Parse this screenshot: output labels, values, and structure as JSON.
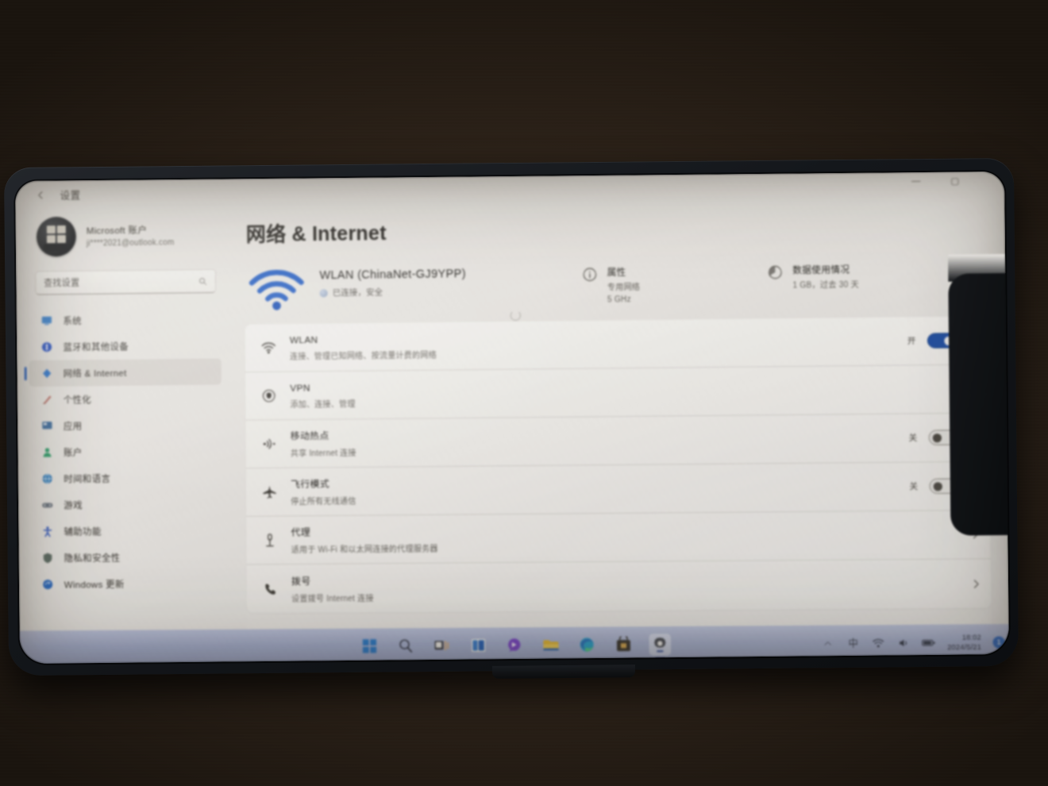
{
  "window": {
    "titlebar_title": "设置",
    "back_icon": "back-arrow-icon",
    "minimize_label": "—",
    "maximize_label": "▢"
  },
  "account": {
    "name": "Microsoft 账户",
    "email": "ji****2021@outlook.com",
    "avatar_icon": "windows-logo-avatar"
  },
  "search": {
    "placeholder": "查找设置",
    "icon": "search-icon"
  },
  "sidebar": {
    "items": [
      {
        "label": "系统",
        "icon": "system-icon",
        "color": "#2c7fd6",
        "active": false
      },
      {
        "label": "蓝牙和其他设备",
        "icon": "bluetooth-icon",
        "color": "#1f4fd0",
        "active": false
      },
      {
        "label": "网络 & Internet",
        "icon": "network-icon",
        "color": "#2677d8",
        "active": true
      },
      {
        "label": "个性化",
        "icon": "personalization-icon",
        "color": "#c0655a",
        "active": false
      },
      {
        "label": "应用",
        "icon": "apps-icon",
        "color": "#3a6ea5",
        "active": false
      },
      {
        "label": "账户",
        "icon": "accounts-icon",
        "color": "#2aa36b",
        "active": false
      },
      {
        "label": "时间和语言",
        "icon": "time-language-icon",
        "color": "#2b7fc4",
        "active": false
      },
      {
        "label": "游戏",
        "icon": "gaming-icon",
        "color": "#6c7580",
        "active": false
      },
      {
        "label": "辅助功能",
        "icon": "accessibility-icon",
        "color": "#2250c8",
        "active": false
      },
      {
        "label": "隐私和安全性",
        "icon": "privacy-security-icon",
        "color": "#5b6b62",
        "active": false
      },
      {
        "label": "Windows 更新",
        "icon": "windows-update-icon",
        "color": "#2268c9",
        "active": false
      }
    ]
  },
  "page": {
    "title": "网络 & Internet",
    "status": {
      "wifi_icon": "wifi-signal-icon",
      "connection_name": "WLAN (ChinaNet-GJ9YPP)",
      "connection_sub": "已连接，安全",
      "connection_sub_icon": "globe-icon",
      "spinner_icon": "loading-spinner-icon",
      "cards": [
        {
          "icon": "properties-info-icon",
          "title": "属性",
          "sub": "专用网络\n5 GHz",
          "chevron": false
        },
        {
          "icon": "data-usage-icon",
          "title": "数据使用情况",
          "sub": "1 GB，过去 30 天",
          "chevron": true
        }
      ]
    },
    "rows": [
      {
        "icon": "wlan-icon",
        "title": "WLAN",
        "sub": "连接、管理已知网络、按流量计费的网络",
        "toggle": {
          "present": true,
          "state": "on",
          "label": "开"
        },
        "chevron": true
      },
      {
        "icon": "vpn-shield-icon",
        "title": "VPN",
        "sub": "添加、连接、管理",
        "toggle": {
          "present": false
        },
        "chevron": true
      },
      {
        "icon": "mobile-hotspot-icon",
        "title": "移动热点",
        "sub": "共享 Internet 连接",
        "toggle": {
          "present": true,
          "state": "off",
          "label": "关"
        },
        "chevron": true
      },
      {
        "icon": "airplane-mode-icon",
        "title": "飞行模式",
        "sub": "停止所有无线通信",
        "toggle": {
          "present": true,
          "state": "off",
          "label": "关"
        },
        "chevron": true
      },
      {
        "icon": "proxy-icon",
        "title": "代理",
        "sub": "适用于 Wi-Fi 和以太网连接的代理服务器",
        "toggle": {
          "present": false
        },
        "chevron": true
      },
      {
        "icon": "dialup-icon",
        "title": "拨号",
        "sub": "设置拨号 Internet 连接",
        "toggle": {
          "present": false
        },
        "chevron": true
      }
    ]
  },
  "taskbar": {
    "icons": [
      {
        "name": "start-button",
        "label": "开始"
      },
      {
        "name": "search-taskbar-icon",
        "label": "搜索"
      },
      {
        "name": "task-view-icon",
        "label": "任务视图"
      },
      {
        "name": "widgets-icon",
        "label": "小组件"
      },
      {
        "name": "chat-icon",
        "label": "聊天"
      },
      {
        "name": "file-explorer-icon",
        "label": "文件资源管理器"
      },
      {
        "name": "edge-browser-icon",
        "label": "Microsoft Edge"
      },
      {
        "name": "microsoft-store-icon",
        "label": "Microsoft Store"
      },
      {
        "name": "settings-app-icon",
        "label": "设置",
        "active": true
      }
    ],
    "tray": {
      "overflow_icon": "chevron-up-icon",
      "ime_label": "中",
      "network_icon": "wifi-tray-icon",
      "volume_icon": "speaker-tray-icon",
      "battery_icon": "battery-tray-icon",
      "clock_time": "18:02",
      "clock_date": "2024/5/21",
      "notification_badge": "1"
    }
  },
  "colors": {
    "accent": "#1b4fae",
    "wifi_blue": "#1a5fd0",
    "taskbar": "#a5b0d4",
    "surface": "#ece9e4",
    "room": "#2a2018"
  }
}
